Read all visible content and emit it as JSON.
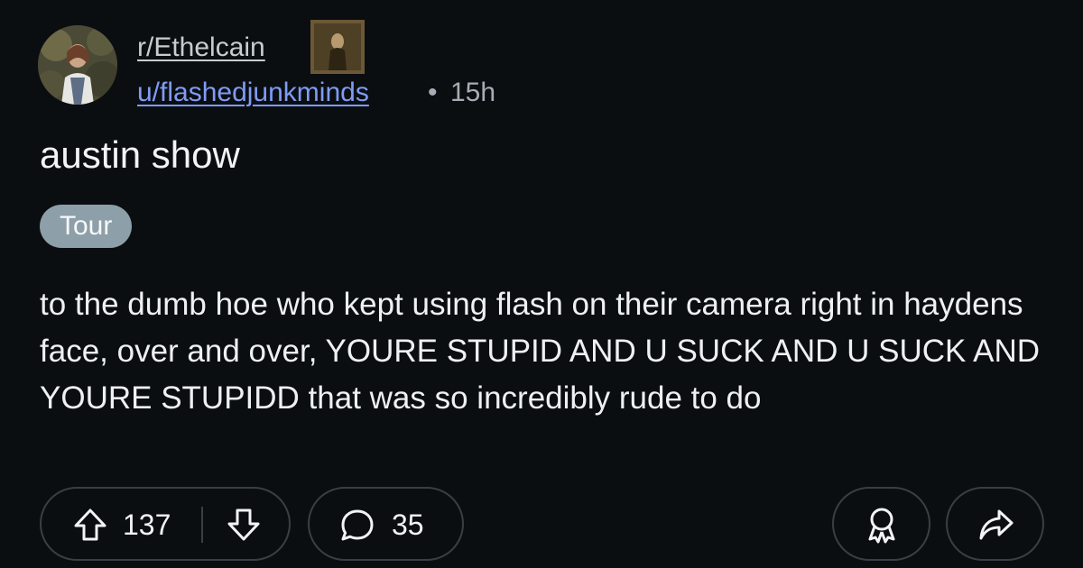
{
  "post": {
    "subreddit": "r/Ethelcain",
    "author": "u/flashedjunkminds",
    "separator": "•",
    "age": "15h",
    "title": "austin show",
    "flair": "Tour",
    "body": "to the dumb hoe who kept using flash on their camera right in haydens face, over and over, YOURE STUPID AND U SUCK AND U SUCK AND YOURE STUPIDD that was so incredibly rude to do"
  },
  "actions": {
    "upvotes": "137",
    "comments": "35"
  },
  "icons": {
    "upvote": "arrow-up-outline-icon",
    "downvote": "arrow-down-outline-icon",
    "comment": "speech-bubble-icon",
    "award": "award-ribbon-icon",
    "share": "share-arrow-icon"
  },
  "colors": {
    "background": "#0b0e11",
    "user_link": "#7f9cf5",
    "flair_bg": "#8d9fa8",
    "pill_border": "#3a3f45"
  }
}
